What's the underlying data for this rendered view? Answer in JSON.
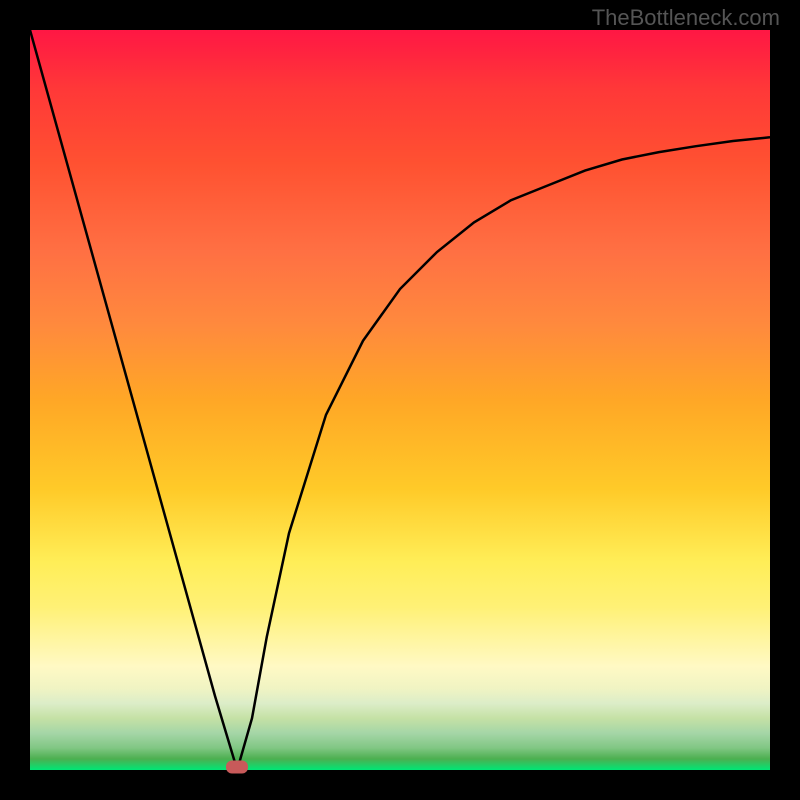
{
  "watermark": "TheBottleneck.com",
  "chart_data": {
    "type": "line",
    "title": "",
    "xlabel": "",
    "ylabel": "",
    "xlim": [
      0,
      100
    ],
    "ylim": [
      0,
      100
    ],
    "background_gradient": {
      "top_color": "#ff1744",
      "bottom_color": "#00e676",
      "description": "red-to-green vertical gradient representing bottleneck level"
    },
    "series": [
      {
        "name": "bottleneck-curve",
        "description": "V-shaped curve showing deviation from optimal balance point",
        "x": [
          0,
          5,
          10,
          15,
          20,
          25,
          28,
          30,
          32,
          35,
          40,
          45,
          50,
          55,
          60,
          65,
          70,
          75,
          80,
          85,
          90,
          95,
          100
        ],
        "values": [
          100,
          82,
          64,
          46,
          28,
          10,
          0,
          7,
          18,
          32,
          48,
          58,
          65,
          70,
          74,
          77,
          79,
          81,
          82.5,
          83.5,
          84.3,
          85,
          85.5
        ]
      }
    ],
    "optimal_point": {
      "x": 28,
      "y": 0,
      "marker_color": "#c85a5a"
    }
  }
}
